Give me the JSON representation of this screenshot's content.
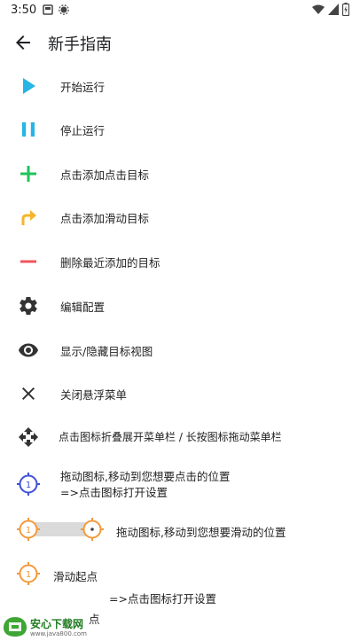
{
  "status": {
    "time": "3:50"
  },
  "appbar": {
    "title": "新手指南"
  },
  "items": [
    {
      "label": "开始运行",
      "icon": "play-icon",
      "color": "#26B5E5"
    },
    {
      "label": "停止运行",
      "icon": "pause-icon",
      "color": "#26B5E5"
    },
    {
      "label": "点击添加点击目标",
      "icon": "plus-icon",
      "color": "#22C35B"
    },
    {
      "label": "点击添加滑动目标",
      "icon": "swipe-arrow-icon",
      "color": "#F5B52A"
    },
    {
      "label": "删除最近添加的目标",
      "icon": "minus-icon",
      "color": "#F2535E"
    },
    {
      "label": "编辑配置",
      "icon": "gear-icon",
      "color": "#333333"
    },
    {
      "label": "显示/隐藏目标视图",
      "icon": "eye-icon",
      "color": "#333333"
    },
    {
      "label": "关闭悬浮菜单",
      "icon": "close-icon",
      "color": "#333333"
    },
    {
      "label": "点击图标折叠展开菜单栏 / 长按图标拖动菜单栏",
      "icon": "move-icon",
      "color": "#333333"
    }
  ],
  "click_target": {
    "number": "1",
    "line1": "拖动图标,移动到您想要点击的位置",
    "line2": "=>点击图标打开设置",
    "color": "#3F51D8"
  },
  "swipe_target": {
    "number": "1",
    "label": "拖动图标,移动到您想要滑动的位置",
    "color": "#F39A3C"
  },
  "swipe_start": {
    "number": "1",
    "label": "滑动起点"
  },
  "open_settings": "=>点击图标打开设置",
  "swipe_end_partial": "点",
  "watermark": {
    "text": "安心下载网",
    "url": "www.java800.com"
  }
}
